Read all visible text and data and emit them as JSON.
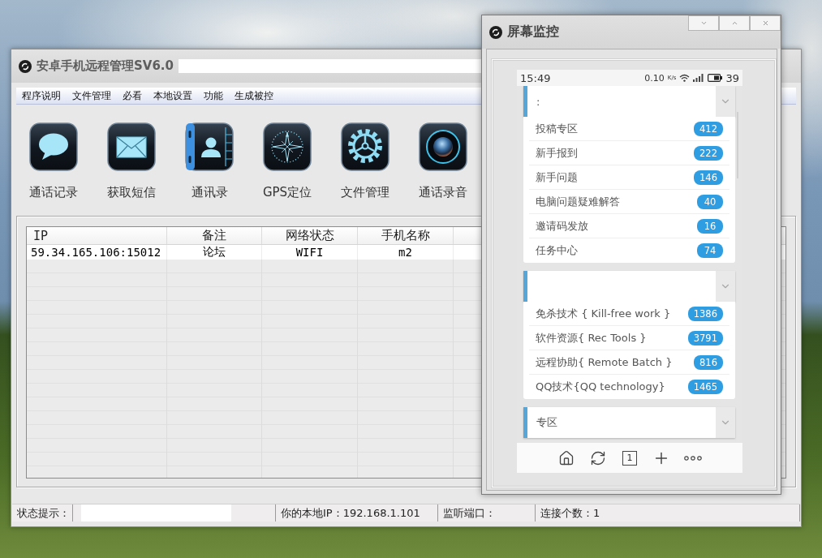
{
  "main_window": {
    "title": {
      "text": "安卓手机远程管理SV6.0",
      "redacted": true
    },
    "menu": [
      "程序说明",
      "文件管理",
      "必看",
      "本地设置",
      "功能",
      "生成被控"
    ],
    "toolbar": [
      "通话记录",
      "获取短信",
      "通讯录",
      "GPS定位",
      "文件管理",
      "通话录音"
    ],
    "table": {
      "columns": [
        "IP",
        "备注",
        "网络状态",
        "手机名称"
      ],
      "rows": [
        [
          "59.34.165.106:15012",
          "论坛",
          "WIFI",
          "m2"
        ]
      ]
    },
    "status_bar": [
      {
        "text": "状态提示："
      },
      {
        "redacted": true
      },
      {
        "text": "你的本地IP：192.168.1.101"
      },
      {
        "text": "监听端口："
      },
      {
        "text": "连接个数：1"
      }
    ]
  },
  "monitor_window": {
    "title": "屏幕监控",
    "phone": {
      "status_bar": {
        "time": "15:49",
        "net_speed": "0.10",
        "speed_unit": "K/s",
        "battery": "39"
      },
      "sections": [
        {
          "title": ":",
          "items": [
            {
              "name": "投稿专区",
              "count": "412"
            },
            {
              "name": "新手报到",
              "count": "222"
            },
            {
              "name": "新手问题",
              "count": "146"
            },
            {
              "name": "电脑问题疑难解答",
              "count": "40"
            },
            {
              "name": "邀请码发放",
              "count": "16"
            },
            {
              "name": "任务中心",
              "count": "74"
            }
          ]
        },
        {
          "items": [
            {
              "name": "免杀技术 { Kill-free work }",
              "count": "1386"
            },
            {
              "name": "软件资源{ Rec Tools }",
              "count": "3791"
            },
            {
              "name": "远程协助{ Remote Batch }",
              "count": "816"
            },
            {
              "name": "QQ技术{QQ technology}",
              "count": "1465"
            }
          ]
        },
        {
          "title": "专区"
        }
      ],
      "bottom_nav": {
        "tab_count": "1"
      }
    }
  }
}
